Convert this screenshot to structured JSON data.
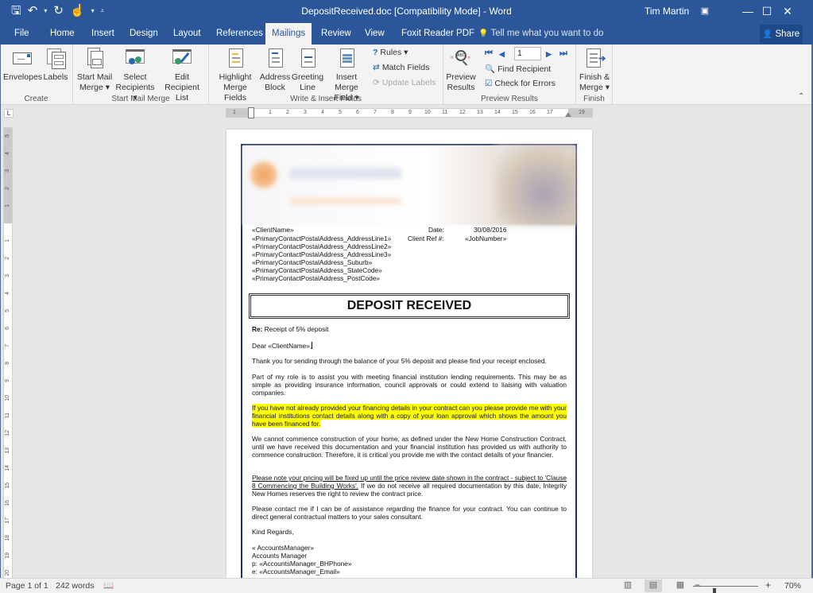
{
  "window": {
    "title": "DepositReceived.doc [Compatibility Mode] - Word",
    "user": "Tim Martin",
    "controls": {
      "ribbon_display": "▣",
      "minimize": "—",
      "maximize": "☐",
      "close": "✕"
    }
  },
  "qat": {
    "save": "🖫",
    "undo": "↶",
    "undo_dropdown": "▾",
    "redo": "↻",
    "touch": "☝",
    "touch_dropdown": "▾",
    "customize": "⩡"
  },
  "tabs": [
    {
      "label": "File"
    },
    {
      "label": "Home"
    },
    {
      "label": "Insert"
    },
    {
      "label": "Design"
    },
    {
      "label": "Layout"
    },
    {
      "label": "References"
    },
    {
      "label": "Mailings",
      "active": true
    },
    {
      "label": "Review"
    },
    {
      "label": "View"
    },
    {
      "label": "Foxit Reader PDF"
    }
  ],
  "tell_me": {
    "icon": "💡",
    "text": "Tell me what you want to do"
  },
  "share": {
    "icon": "👤",
    "label": "Share"
  },
  "ribbon": {
    "groups": {
      "create": "Create",
      "start_mail_merge": "Start Mail Merge",
      "write_insert": "Write & Insert Fields",
      "preview": "Preview Results",
      "finish": "Finish"
    },
    "buttons": {
      "envelopes": "Envelopes",
      "labels": "Labels",
      "start_mail_merge_1": "Start Mail",
      "start_mail_merge_2": "Merge ▾",
      "select_recipients_1": "Select",
      "select_recipients_2": "Recipients ▾",
      "edit_recipient_1": "Edit",
      "edit_recipient_2": "Recipient List",
      "highlight_1": "Highlight",
      "highlight_2": "Merge Fields",
      "address_1": "Address",
      "address_2": "Block",
      "greeting_1": "Greeting",
      "greeting_2": "Line",
      "insert_field_1": "Insert Merge",
      "insert_field_2": "Field ▾",
      "rules": "Rules ▾",
      "match_fields": "Match Fields",
      "update_labels": "Update Labels",
      "preview_1": "Preview",
      "preview_2": "Results",
      "record_number": "1",
      "find_recipient": "Find Recipient",
      "check_errors": "Check for Errors",
      "finish_1": "Finish &",
      "finish_2": "Merge ▾",
      "collapse": "⌃"
    },
    "nav": {
      "first": "⏮",
      "prev": "◀",
      "next": "▶",
      "last": "⏭"
    }
  },
  "ruler": {
    "horizontal": [
      "1",
      "1",
      "2",
      "3",
      "4",
      "5",
      "6",
      "7",
      "8",
      "9",
      "10",
      "11",
      "12",
      "13",
      "14",
      "15",
      "16",
      "17",
      "19"
    ],
    "vertical": [
      "5",
      "4",
      "3",
      "2",
      "1",
      "1",
      "2",
      "3",
      "4",
      "5",
      "6",
      "7",
      "8",
      "9",
      "10",
      "11",
      "12",
      "13",
      "14",
      "15",
      "16",
      "17",
      "18",
      "19",
      "20"
    ],
    "corner": "L"
  },
  "document": {
    "client_name": "«ClientName»",
    "date_label": "Date:",
    "date_value": "30/08/2016",
    "client_ref_label": "Client Ref #:",
    "client_ref_value": "«JobNumber»",
    "address_lines": [
      "«PrimaryContactPostalAddress_AddressLine1»",
      "«PrimaryContactPostalAddress_AddressLine2»",
      "«PrimaryContactPostalAddress_AddressLine3»",
      "«PrimaryContactPostalAddress_Suburb»",
      "«PrimaryContactPostalAddress_StateCode»",
      "«PrimaryContactPostalAddress_PostCode»"
    ],
    "heading": "DEPOSIT RECEIVED",
    "re_label": "Re:",
    "re_text": " Receipt of 5% deposit",
    "salutation": "Dear «ClientName»,",
    "p1": "Thank you for sending through the balance of your 5% deposit and please find your receipt enclosed.",
    "p2": "Part of my role is to assist you with meeting financial institution lending requirements.  This may be as simple as providing insurance information, council approvals or could extend to liaising with valuation companies.",
    "p3": "If you have not already provided your financing details in your contract can you please provide me with your financial institutions contact details along with a copy of your loan approval which shows the amount you have been financed for.",
    "p4": "We cannot commence construction of your home, as defined under the New Home Construction Contract, until we have received this documentation and your financial institution has provided us with authority to commence construction. Therefore, it is critical you provide me with the contact details of your financier.",
    "p5_underlined": "Please note your pricing will be fixed up until the price review date shown in the contract - subject to 'Clause 8 Commencing the Building Works'.",
    "p5_rest": " If we do not receive all required documentation by this date, Integrity New Homes reserves the right to review the contract price.",
    "p6": "Please contact me if I can be of assistance regarding the finance for your contract. You can continue to direct general contractual matters to your sales consultant.",
    "closing": "Kind Regards,",
    "sig_name": "« AccountsManager»",
    "sig_title": "Accounts Manager",
    "sig_phone": "p: «AccountsManager_BHPhone»",
    "sig_email": "e: «AccountsManager_Email»"
  },
  "status": {
    "page": "Page 1 of 1",
    "words": "242 words",
    "proofing_icon": "📖",
    "zoom_minus": "−",
    "zoom_plus": "+",
    "zoom_level": "70%",
    "zoom_percent": 70
  }
}
